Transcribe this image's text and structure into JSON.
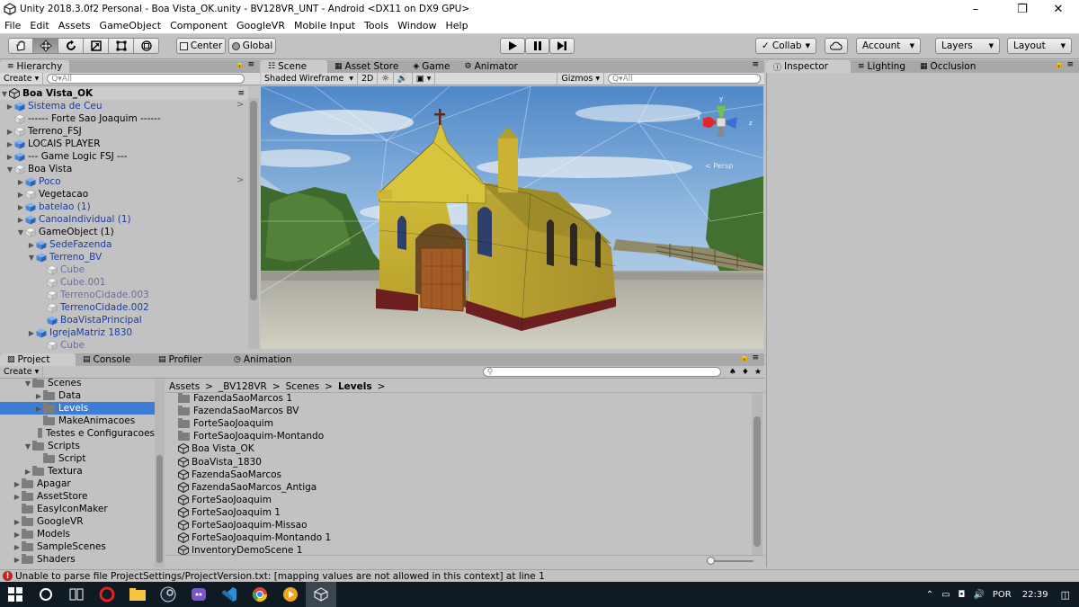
{
  "window": {
    "title": "Unity 2018.3.0f2 Personal - Boa Vista_OK.unity - BV128VR_UNT - Android <DX11 on DX9 GPU>"
  },
  "menu": [
    "File",
    "Edit",
    "Assets",
    "GameObject",
    "Component",
    "GoogleVR",
    "Mobile Input",
    "Tools",
    "Window",
    "Help"
  ],
  "toolbar": {
    "center": "Center",
    "global": "Global",
    "collab": "Collab",
    "account": "Account",
    "layers": "Layers",
    "layout": "Layout"
  },
  "hierarchy": {
    "tab": "Hierarchy",
    "create": "Create",
    "search_placeholder": "All",
    "scene": "Boa Vista_OK",
    "rows": [
      {
        "label": "Sistema de Ceu",
        "depth": 1,
        "arrow": "right",
        "style": "blue",
        "icon": "prefab"
      },
      {
        "label": "------ Forte Sao Joaquim ------",
        "depth": 1,
        "arrow": "none",
        "style": "normal",
        "icon": "go"
      },
      {
        "label": "Terreno_FSJ",
        "depth": 1,
        "arrow": "right",
        "style": "normal",
        "icon": "go"
      },
      {
        "label": "LOCAIS PLAYER",
        "depth": 1,
        "arrow": "right",
        "style": "normal",
        "icon": "prefab"
      },
      {
        "label": "--- Game Logic FSJ ---",
        "depth": 1,
        "arrow": "right",
        "style": "normal",
        "icon": "prefab"
      },
      {
        "label": "Boa Vista",
        "depth": 1,
        "arrow": "down",
        "style": "normal",
        "icon": "go"
      },
      {
        "label": "Poco",
        "depth": 2,
        "arrow": "right",
        "style": "blue",
        "icon": "prefab"
      },
      {
        "label": "Vegetacao",
        "depth": 2,
        "arrow": "right",
        "style": "normal",
        "icon": "go"
      },
      {
        "label": "batelao (1)",
        "depth": 2,
        "arrow": "right",
        "style": "blue",
        "icon": "prefab"
      },
      {
        "label": "CanoaIndividual (1)",
        "depth": 2,
        "arrow": "right",
        "style": "blue",
        "icon": "prefab"
      },
      {
        "label": "GameObject (1)",
        "depth": 2,
        "arrow": "down",
        "style": "normal",
        "icon": "go"
      },
      {
        "label": "SedeFazenda",
        "depth": 3,
        "arrow": "right",
        "style": "blue",
        "icon": "prefab"
      },
      {
        "label": "Terreno_BV",
        "depth": 3,
        "arrow": "down",
        "style": "blue",
        "icon": "prefab"
      },
      {
        "label": "Cube",
        "depth": 4,
        "arrow": "none",
        "style": "grey",
        "icon": "go"
      },
      {
        "label": "Cube.001",
        "depth": 4,
        "arrow": "none",
        "style": "grey",
        "icon": "go"
      },
      {
        "label": "TerrenoCidade.003",
        "depth": 4,
        "arrow": "none",
        "style": "grey",
        "icon": "go"
      },
      {
        "label": "TerrenoCidade.002",
        "depth": 4,
        "arrow": "none",
        "style": "blue",
        "icon": "go"
      },
      {
        "label": "BoaVistaPrincipal",
        "depth": 4,
        "arrow": "none",
        "style": "blue",
        "icon": "prefab"
      },
      {
        "label": "IgrejaMatriz 1830",
        "depth": 3,
        "arrow": "right",
        "style": "blue",
        "icon": "prefab"
      },
      {
        "label": "Cube",
        "depth": 4,
        "arrow": "none",
        "style": "grey",
        "icon": "go"
      }
    ]
  },
  "scene_tabs": [
    "Scene",
    "Asset Store",
    "Game",
    "Animator"
  ],
  "scene_bar": {
    "shading": "Shaded Wireframe",
    "mode2d": "2D",
    "gizmos": "Gizmos",
    "search_placeholder": "All",
    "persp": "< Persp"
  },
  "inspector_tabs": [
    "Inspector",
    "Lighting",
    "Occlusion"
  ],
  "bottom_tabs": [
    "Project",
    "Console",
    "Profiler",
    "Animation"
  ],
  "project": {
    "create": "Create",
    "folders": [
      {
        "label": "Scenes",
        "depth": 2,
        "arrow": "down",
        "selected": false
      },
      {
        "label": "Data",
        "depth": 3,
        "arrow": "right",
        "selected": false
      },
      {
        "label": "Levels",
        "depth": 3,
        "arrow": "right",
        "selected": true
      },
      {
        "label": "MakeAnimacoes",
        "depth": 3,
        "arrow": "none",
        "selected": false
      },
      {
        "label": "Testes e Configuracoes",
        "depth": 3,
        "arrow": "none",
        "selected": false
      },
      {
        "label": "Scripts",
        "depth": 2,
        "arrow": "down",
        "selected": false
      },
      {
        "label": "Script",
        "depth": 3,
        "arrow": "none",
        "selected": false
      },
      {
        "label": "Textura",
        "depth": 2,
        "arrow": "right",
        "selected": false
      },
      {
        "label": "Apagar",
        "depth": 1,
        "arrow": "right",
        "selected": false
      },
      {
        "label": "AssetStore",
        "depth": 1,
        "arrow": "right",
        "selected": false
      },
      {
        "label": "EasyIconMaker",
        "depth": 1,
        "arrow": "none",
        "selected": false
      },
      {
        "label": "GoogleVR",
        "depth": 1,
        "arrow": "right",
        "selected": false
      },
      {
        "label": "Models",
        "depth": 1,
        "arrow": "right",
        "selected": false
      },
      {
        "label": "SampleScenes",
        "depth": 1,
        "arrow": "right",
        "selected": false
      },
      {
        "label": "Shaders",
        "depth": 1,
        "arrow": "right",
        "selected": false
      }
    ],
    "breadcrumb": [
      "Assets",
      "_BV128VR",
      "Scenes",
      "Levels"
    ],
    "files": [
      {
        "label": "FazendaSaoMarcos 1",
        "type": "folder"
      },
      {
        "label": "FazendaSaoMarcos BV",
        "type": "folder"
      },
      {
        "label": "ForteSaoJoaquim",
        "type": "folder"
      },
      {
        "label": "ForteSaoJoaquim-Montando",
        "type": "folder"
      },
      {
        "label": "Boa Vista_OK",
        "type": "scene"
      },
      {
        "label": "BoaVista_1830",
        "type": "scene"
      },
      {
        "label": "FazendaSaoMarcos",
        "type": "scene"
      },
      {
        "label": "FazendaSaoMarcos_Antiga",
        "type": "scene"
      },
      {
        "label": "ForteSaoJoaquim",
        "type": "scene"
      },
      {
        "label": "ForteSaoJoaquim 1",
        "type": "scene"
      },
      {
        "label": "ForteSaoJoaquim-Missao",
        "type": "scene"
      },
      {
        "label": "ForteSaoJoaquim-Montando 1",
        "type": "scene"
      },
      {
        "label": "InventoryDemoScene 1",
        "type": "scene"
      }
    ]
  },
  "status": "Unable to parse file ProjectSettings/ProjectVersion.txt: [mapping values are not allowed in this context] at line 1",
  "taskbar": {
    "lang": "POR",
    "time": "22:39"
  },
  "colors": {
    "error": "#d21c1c",
    "selected": "#3e7dd6",
    "prefab_text": "#1a3ca0",
    "taskbar": "#101a22"
  }
}
